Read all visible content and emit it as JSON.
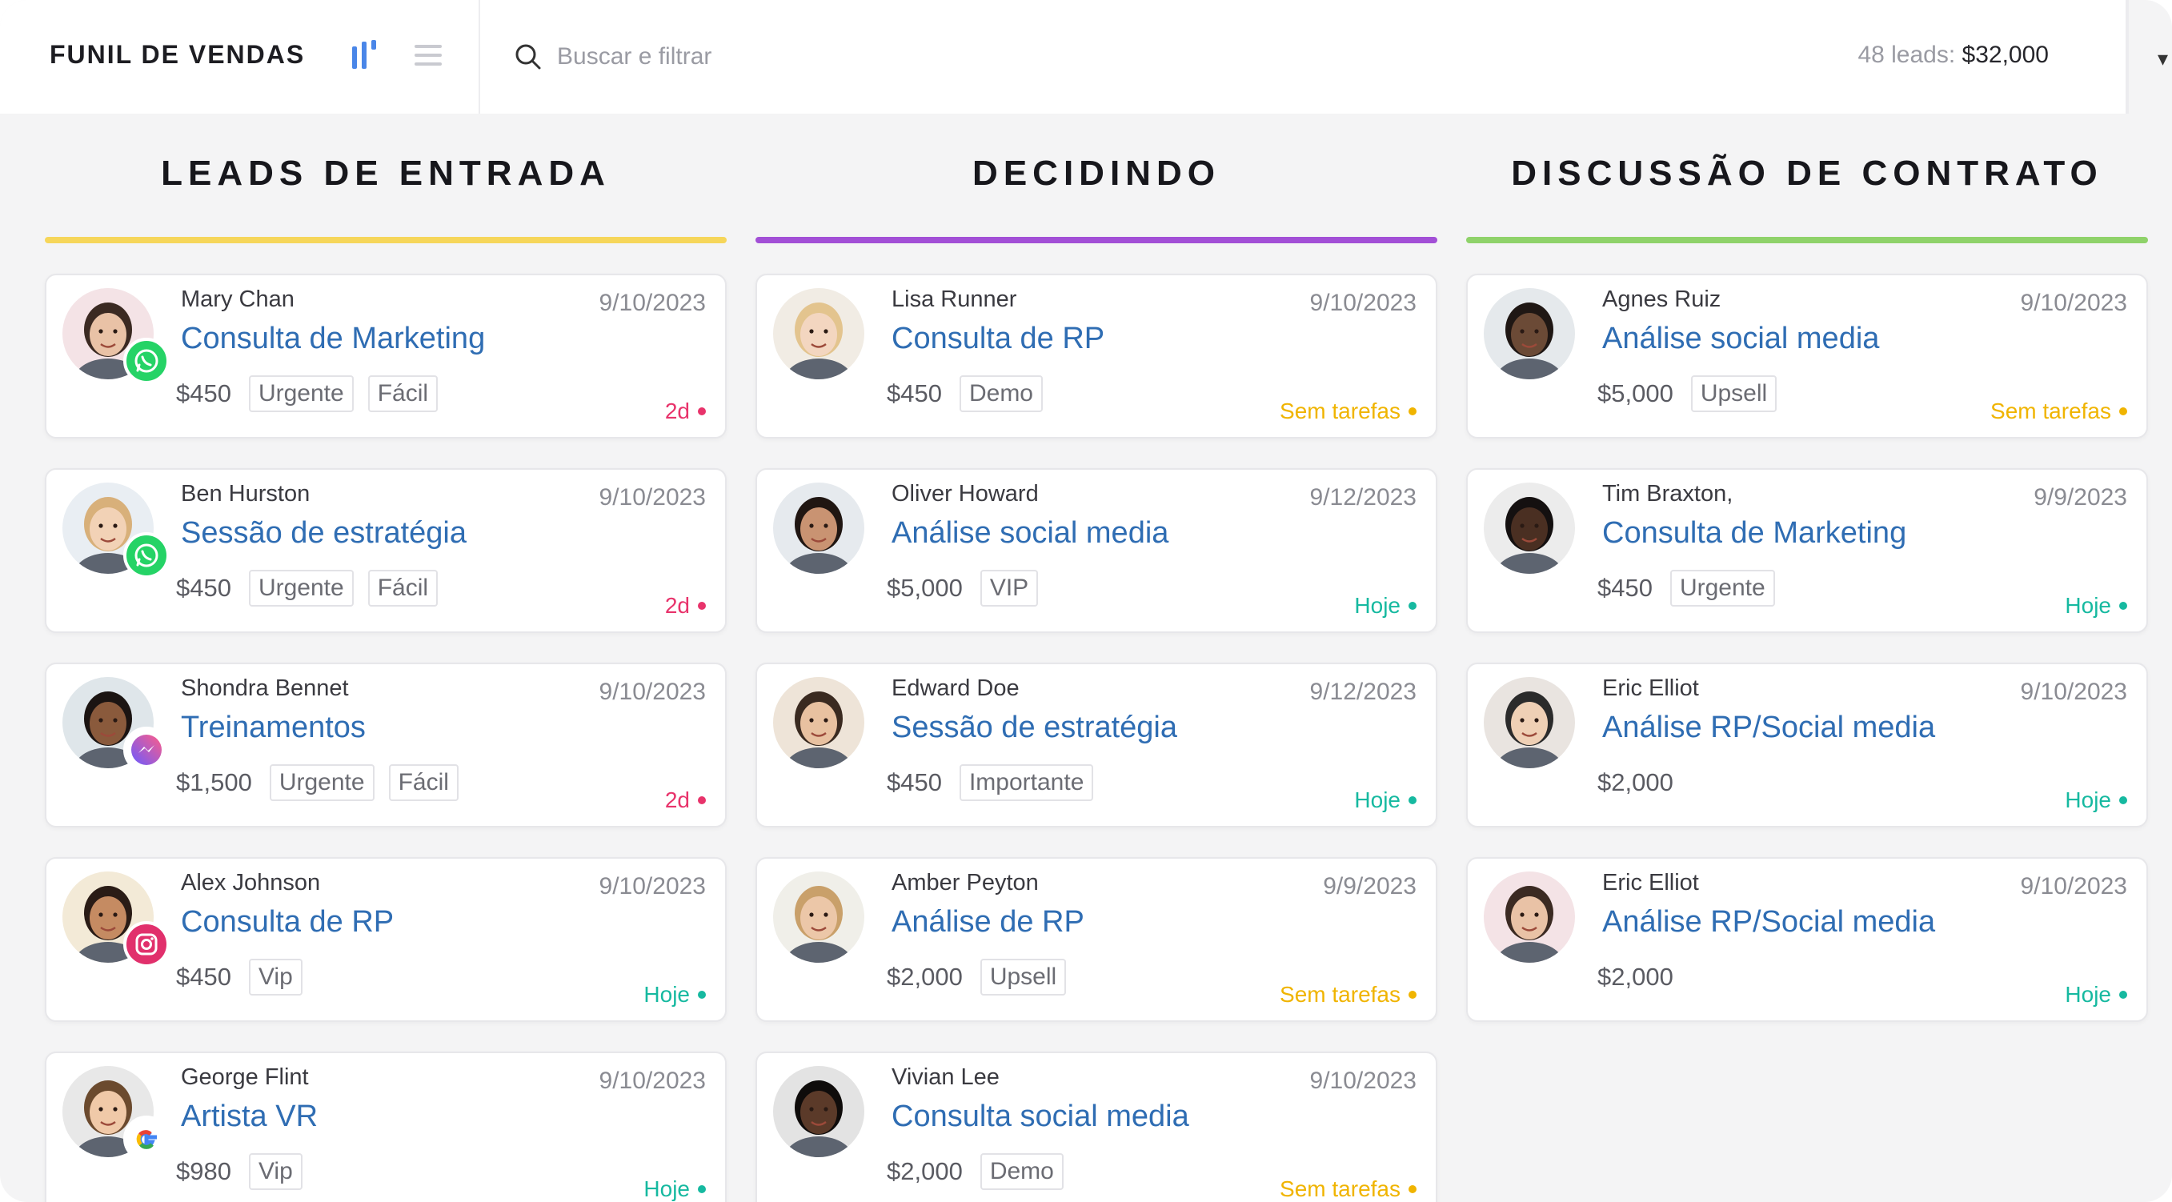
{
  "header": {
    "title": "FUNIL DE VENDAS",
    "search_placeholder": "Buscar e filtrar",
    "totals_label": "48 leads:",
    "totals_value": "$32,000"
  },
  "colors": {
    "leads": "#f6d65a",
    "decidindo": "#a24fd6",
    "contrato": "#8fd26a",
    "link": "#2f6db3",
    "overdue": "#e8336b",
    "today": "#16b9a0",
    "no_tasks": "#f0b400"
  },
  "columns": [
    {
      "title": "LEADS DE ENTRADA",
      "cards": [
        {
          "name": "Mary Chan",
          "deal": "Consulta de Marketing",
          "date": "9/10/2023",
          "price": "$450",
          "tags": [
            "Urgente",
            "Fácil"
          ],
          "status": "2d",
          "status_type": "overdue",
          "channel": "whatsapp-icon"
        },
        {
          "name": "Ben Hurston",
          "deal": "Sessão de estratégia",
          "date": "9/10/2023",
          "price": "$450",
          "tags": [
            "Urgente",
            "Fácil"
          ],
          "status": "2d",
          "status_type": "overdue",
          "channel": "whatsapp-icon"
        },
        {
          "name": "Shondra Bennet",
          "deal": "Treinamentos",
          "date": "9/10/2023",
          "price": "$1,500",
          "tags": [
            "Urgente",
            "Fácil"
          ],
          "status": "2d",
          "status_type": "overdue",
          "channel": "messenger-icon"
        },
        {
          "name": "Alex Johnson",
          "deal": "Consulta de RP",
          "date": "9/10/2023",
          "price": "$450",
          "tags": [
            "Vip"
          ],
          "status": "Hoje",
          "status_type": "today",
          "channel": "instagram-icon"
        },
        {
          "name": "George Flint",
          "deal": "Artista VR",
          "date": "9/10/2023",
          "price": "$980",
          "tags": [
            "Vip"
          ],
          "status": "Hoje",
          "status_type": "today",
          "channel": "google-icon"
        }
      ]
    },
    {
      "title": "DECIDINDO",
      "cards": [
        {
          "name": "Lisa Runner",
          "deal": "Consulta de RP",
          "date": "9/10/2023",
          "price": "$450",
          "tags": [
            "Demo"
          ],
          "status": "Sem tarefas",
          "status_type": "no_tasks",
          "channel": ""
        },
        {
          "name": "Oliver Howard",
          "deal": "Análise social media",
          "date": "9/12/2023",
          "price": "$5,000",
          "tags": [
            "VIP"
          ],
          "status": "Hoje",
          "status_type": "today",
          "channel": ""
        },
        {
          "name": "Edward Doe",
          "deal": "Sessão de estratégia",
          "date": "9/12/2023",
          "price": "$450",
          "tags": [
            "Importante"
          ],
          "status": "Hoje",
          "status_type": "today",
          "channel": ""
        },
        {
          "name": "Amber Peyton",
          "deal": "Análise de RP",
          "date": "9/9/2023",
          "price": "$2,000",
          "tags": [
            "Upsell"
          ],
          "status": "Sem tarefas",
          "status_type": "no_tasks",
          "channel": ""
        },
        {
          "name": "Vivian Lee",
          "deal": "Consulta social media",
          "date": "9/10/2023",
          "price": "$2,000",
          "tags": [
            "Demo"
          ],
          "status": "Sem tarefas",
          "status_type": "no_tasks",
          "channel": ""
        }
      ]
    },
    {
      "title": "DISCUSSÃO DE CONTRATO",
      "cards": [
        {
          "name": "Agnes Ruiz",
          "deal": "Análise social media",
          "date": "9/10/2023",
          "price": "$5,000",
          "tags": [
            "Upsell"
          ],
          "status": "Sem tarefas",
          "status_type": "no_tasks",
          "channel": ""
        },
        {
          "name": "Tim Braxton,",
          "deal": "Consulta de Marketing",
          "date": "9/9/2023",
          "price": "$450",
          "tags": [
            "Urgente"
          ],
          "status": "Hoje",
          "status_type": "today",
          "channel": ""
        },
        {
          "name": "Eric Elliot",
          "deal": "Análise RP/Social media",
          "date": "9/10/2023",
          "price": "$2,000",
          "tags": [],
          "status": "Hoje",
          "status_type": "today",
          "channel": ""
        },
        {
          "name": "Eric Elliot",
          "deal": "Análise RP/Social media",
          "date": "9/10/2023",
          "price": "$2,000",
          "tags": [],
          "status": "Hoje",
          "status_type": "today",
          "channel": ""
        }
      ]
    }
  ]
}
